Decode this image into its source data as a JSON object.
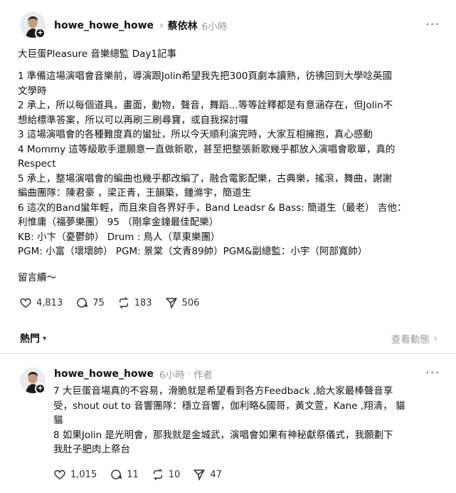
{
  "post": {
    "username": "howe_howe_howe",
    "mention": "蔡依林",
    "time": "6小時",
    "title": "大巨蛋Pleasure 音樂總監 Day1記事",
    "lines": [
      "1 準備這場演唱會音樂前，導演跟Jolin希望我先把300頁劇本讀熟，彷彿回到大學唸英國",
      "文學時",
      "2 承上，所以每個道具，畫面，動物，聲音，舞蹈…等等詮釋都是有意涵存在，但Jolin不",
      "想給標準答案，所以可以再刷三刷尋寶，或自我探討囉",
      "3 這場演唱會的各種難度真的蠻扯，所以今天順利演完時，大家互相擁抱，真心感動",
      "4 Mommy 這等級歌手還願意一直做新歌，甚至把整張新歌幾乎都放入演唱會歌單，真的",
      "Respect",
      "5 承上，整場演唱會的編曲也幾乎都改編了，融合電影配樂，古典樂，搖滾，舞曲，謝謝",
      "編曲團隊：陳君豪 ，梁正青，王韻築，鍾滌宇，簡道生",
      "6 這次的Band蠻年輕，而且來自各界好手，Band Leadsr & Bass: 簡道生（最老） 吉他：",
      "利惟庸（福夢樂團） 95 （剛拿金鐘最佳配樂）",
      "KB: 小卞（憂鬱帥） Drum : 鳥人（草東樂團）",
      "PGM: 小富（壞壞帥） PGM: 景棠（文青89帥）PGM&副總監：小宇（阿部寬帥）"
    ],
    "closing": "留言續～",
    "likes": "4,813",
    "comments": "75",
    "reposts": "183",
    "shares": "506"
  },
  "sort": {
    "label": "熱門",
    "activity_label": "查看動態"
  },
  "reply": {
    "username": "howe_howe_howe",
    "time": "6小時",
    "author_tag": "作者",
    "lines": [
      "7 大巨蛋音場真的不容易，滑脆就是希望看到各方Feedback ,給大家最棒聲音享",
      "受，shout out to 音響團隊：穩立音響，伽利略&國哥，黃文萱，Kane ,翔清， 貓",
      "貓",
      "8 如果Jolin 是光明會，那我就是金城武，演唱會如果有神秘獻祭儀式，我願劃下",
      "我肚子肥肉上祭台"
    ],
    "likes": "1,015",
    "comments": "11",
    "reposts": "10",
    "shares": "47"
  },
  "icons": {
    "heart": "heart-icon",
    "comment": "comment-icon",
    "repost": "repost-icon",
    "share": "share-icon",
    "more": "more-icon"
  },
  "colors": {
    "text": "#101010",
    "muted": "#9a9a9a",
    "divider": "#e3e3e3"
  }
}
